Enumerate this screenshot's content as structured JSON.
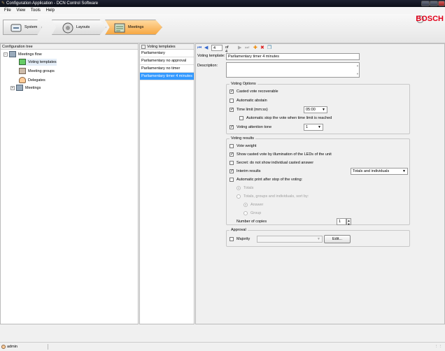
{
  "window": {
    "title": "Configuration Application - DCN Control Software"
  },
  "menu": [
    "File",
    "View",
    "Tools",
    "Help"
  ],
  "brand": "BOSCH",
  "nav": [
    {
      "label": "System"
    },
    {
      "label": "Layouts"
    },
    {
      "label": "Meetings"
    }
  ],
  "left_panel": {
    "header": "Configuration tree",
    "items": [
      "Meetings flow",
      "Voting templates",
      "Meeting groups",
      "Delegates",
      "Meetings"
    ]
  },
  "mid_panel": {
    "header": "Voting templates",
    "items": [
      "Parliamentary",
      "Parliamentary no approval",
      "Parliamentary no timer",
      "Parliamentary timer 4 minutes"
    ],
    "selected_index": 3
  },
  "record_nav": {
    "current": "4",
    "of_text": "of 4"
  },
  "form": {
    "voting_template_label": "Voting template:",
    "voting_template_value": "Parliamentary timer 4 minutes",
    "description_label": "Description:",
    "description_value": "",
    "voting_options": {
      "title": "Voting Options",
      "casted_vote_recoverable": {
        "label": "Casted vote recoverable",
        "checked": true
      },
      "automatic_abstain": {
        "label": "Automatic abstain",
        "checked": false
      },
      "time_limit": {
        "label": "Time limit (mm:ss)",
        "checked": true,
        "value": "05:00"
      },
      "auto_stop": {
        "label": "Automatic stop the vote when time limit is reached",
        "checked": false
      },
      "attention_tone": {
        "label": "Voting attention tone",
        "checked": true,
        "value": "1"
      }
    },
    "voting_results": {
      "title": "Voting results",
      "vote_weight": {
        "label": "Vote weight",
        "checked": false
      },
      "show_casted": {
        "label": "Show casted vote by illumination of the LEDs of the unit",
        "checked": true
      },
      "secret": {
        "label": "Secret: do not show individual casted answer",
        "checked": false
      },
      "interim": {
        "label": "Interim results",
        "checked": true,
        "value": "Totals and individuals"
      },
      "auto_print": {
        "label": "Automatic print after stop of the voting:",
        "checked": false
      },
      "totals_radio": "Totals",
      "groups_radio": "Totals, groups and individuals, sort by:",
      "answer_radio": "Answer",
      "group_radio": "Group",
      "copies_label": "Number of copies",
      "copies_value": "1"
    },
    "approval": {
      "title": "Approval",
      "majority": {
        "label": "Majority",
        "checked": false
      },
      "edit_label": "Edit..."
    }
  },
  "status": {
    "user": "admin"
  },
  "colors": {
    "accent": "#3399ff",
    "brand": "#e2001a",
    "active_nav": "#f7a843"
  }
}
